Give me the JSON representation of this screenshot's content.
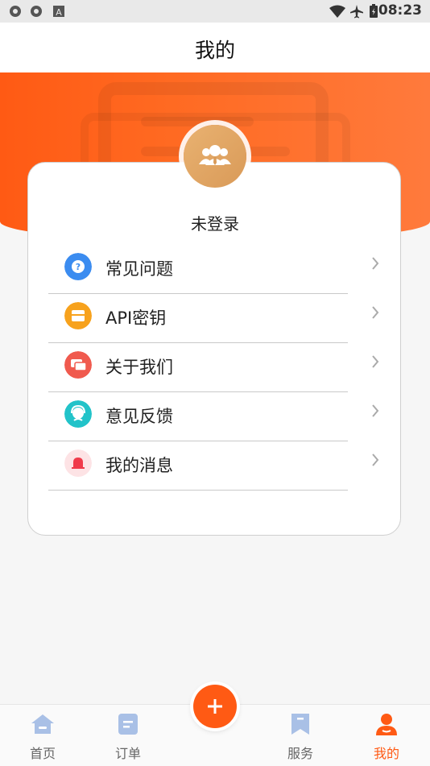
{
  "status_bar": {
    "time": "08:23"
  },
  "header": {
    "title": "我的"
  },
  "profile": {
    "login_status": "未登录"
  },
  "menu": [
    {
      "label": "常见问题",
      "icon": "question-icon",
      "color": "#3b8cf0"
    },
    {
      "label": "API密钥",
      "icon": "api-key-icon",
      "color": "#f7a21d"
    },
    {
      "label": "关于我们",
      "icon": "chat-icon",
      "color": "#f05a4e"
    },
    {
      "label": "意见反馈",
      "icon": "feedback-icon",
      "color": "#22c3c9"
    },
    {
      "label": "我的消息",
      "icon": "bell-icon",
      "color": "#f03a4a"
    }
  ],
  "tabs": [
    {
      "label": "首页",
      "icon": "home-icon",
      "active": false
    },
    {
      "label": "订单",
      "icon": "order-icon",
      "active": false
    },
    {
      "label": "服务",
      "icon": "service-icon",
      "active": false
    },
    {
      "label": "我的",
      "icon": "profile-icon",
      "active": true
    }
  ],
  "colors": {
    "accent": "#ff5a14",
    "inactive": "#a9c0e6"
  }
}
